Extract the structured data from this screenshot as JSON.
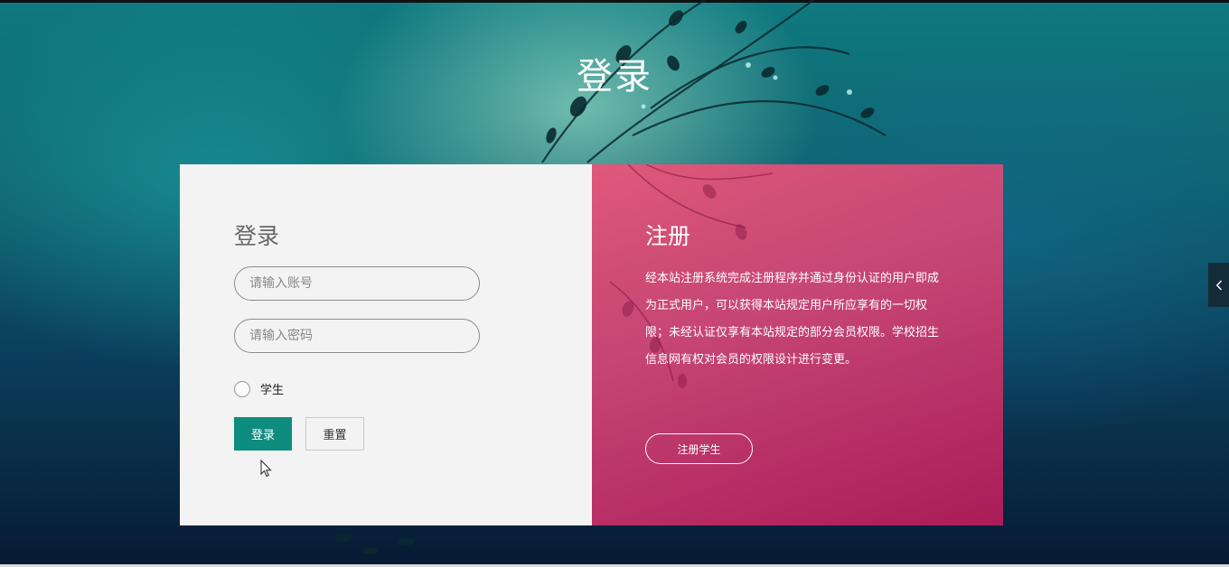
{
  "page": {
    "title": "登录"
  },
  "login": {
    "heading": "登录",
    "account_placeholder": "请输入账号",
    "password_placeholder": "请输入密码",
    "role_option": "学生",
    "login_button": "登录",
    "reset_button": "重置"
  },
  "register": {
    "heading": "注册",
    "description": "经本站注册系统完成注册程序并通过身份认证的用户即成为正式用户，可以获得本站规定用户所应享有的一切权限；未经认证仅享有本站规定的部分会员权限。学校招生信息网有权对会员的权限设计进行变更。",
    "register_button": "注册学生"
  },
  "colors": {
    "login_button_bg": "#0f8c80",
    "register_panel_bg": "#d64676",
    "login_panel_bg": "#f3f3f3"
  },
  "icons": {
    "side_toggle": "chevron-left-icon",
    "cursor": "mouse-pointer-icon"
  }
}
